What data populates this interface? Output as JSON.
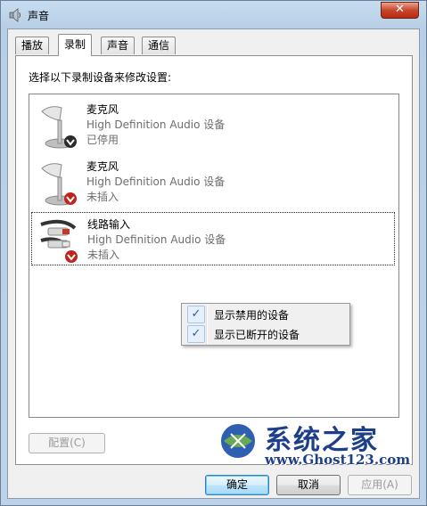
{
  "window": {
    "title": "声音",
    "close_label": "✕"
  },
  "tabs": [
    {
      "label": "播放"
    },
    {
      "label": "录制"
    },
    {
      "label": "声音"
    },
    {
      "label": "通信"
    }
  ],
  "panel": {
    "instruction": "选择以下录制设备来修改设置:"
  },
  "devices": [
    {
      "name": "麦克风",
      "description": "High Definition Audio 设备",
      "status": "已停用",
      "icon": "microphone-icon"
    },
    {
      "name": "麦克风",
      "description": "High Definition Audio 设备",
      "status": "未插入",
      "icon": "microphone-icon"
    },
    {
      "name": "线路输入",
      "description": "High Definition Audio 设备",
      "status": "未插入",
      "icon": "line-in-icon"
    }
  ],
  "context_menu": [
    {
      "label": "显示禁用的设备",
      "checked": true
    },
    {
      "label": "显示已断开的设备",
      "checked": true
    }
  ],
  "buttons": {
    "configure": "配置(C)",
    "ok": "确定",
    "cancel": "取消",
    "apply": "应用(A)"
  },
  "watermark": {
    "title": "系统之家",
    "url": "www.Ghost123.com"
  },
  "colors": {
    "title_bar": "#bcd2e8",
    "close_button": "#c9452a",
    "disabled_text": "#6d6d6d",
    "watermark": "#1d3f8a"
  }
}
